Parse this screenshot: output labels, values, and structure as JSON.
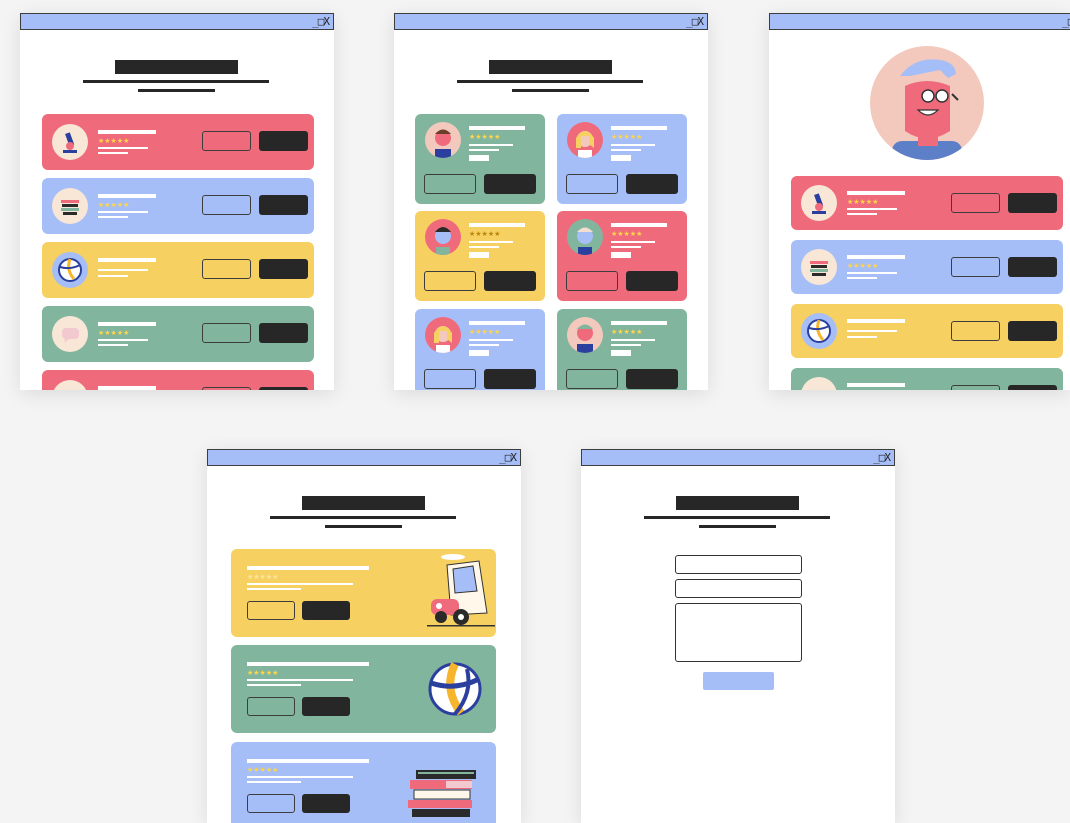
{
  "window_controls": "_□X",
  "stars": "★★★★★",
  "colors": {
    "titlebar": "#a6bef7",
    "red": "#ef6b7c",
    "blue": "#a6bef7",
    "yellow": "#f7d062",
    "green": "#82b59e",
    "dark": "#272727"
  },
  "windows": [
    {
      "name": "course-list-window",
      "card_colors": [
        "red",
        "blue",
        "yellow",
        "green",
        "red"
      ],
      "card_icons": [
        "microscope-icon",
        "books-icon",
        "volleyball-icon",
        "chat-bubble-icon",
        "microscope-icon"
      ]
    },
    {
      "name": "tutor-grid-window",
      "card_colors": [
        "green",
        "blue",
        "yellow",
        "red",
        "blue",
        "green"
      ]
    },
    {
      "name": "tutor-profile-window",
      "card_colors": [
        "red",
        "blue",
        "yellow",
        "green"
      ]
    },
    {
      "name": "featured-courses-window",
      "card_colors": [
        "yellow",
        "green",
        "blue"
      ],
      "illustrations": [
        "car-illustration",
        "volleyball-illustration",
        "books-illustration"
      ]
    },
    {
      "name": "contact-form-window",
      "fields": [
        "name-field",
        "email-field",
        "message-field"
      ]
    }
  ]
}
